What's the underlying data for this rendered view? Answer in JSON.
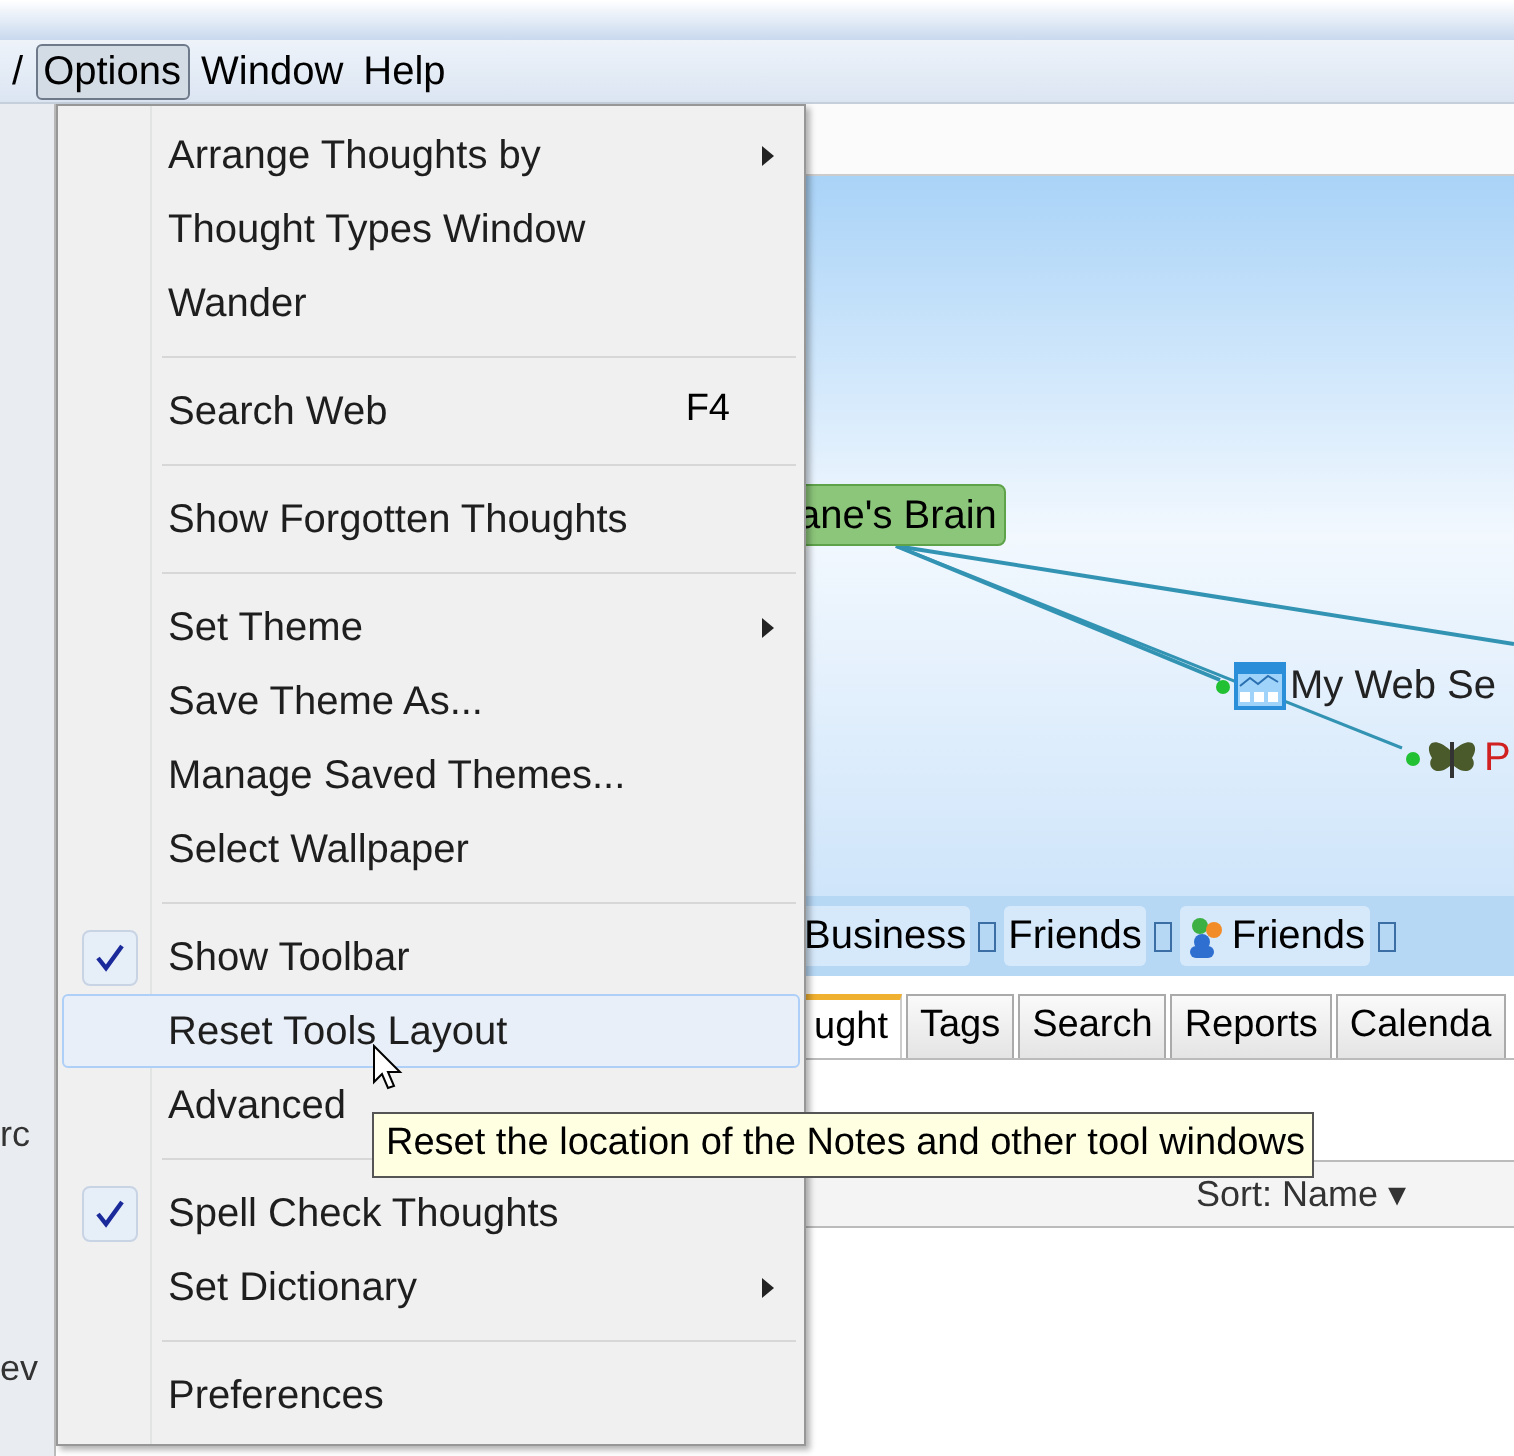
{
  "menubar": [
    {
      "label": "/",
      "selected": false
    },
    {
      "label": "Options",
      "selected": true
    },
    {
      "label": "Window",
      "selected": false
    },
    {
      "label": "Help",
      "selected": false
    }
  ],
  "menu": [
    {
      "kind": "item",
      "label": "Arrange Thoughts by",
      "submenu": true,
      "checked": false,
      "selected": false
    },
    {
      "kind": "item",
      "label": "Thought Types Window",
      "submenu": false,
      "checked": false,
      "selected": false
    },
    {
      "kind": "item",
      "label": "Wander",
      "submenu": false,
      "checked": false,
      "selected": false
    },
    {
      "kind": "separator"
    },
    {
      "kind": "item",
      "label": "Search Web",
      "shortcut": "F4",
      "submenu": false,
      "checked": false,
      "selected": false
    },
    {
      "kind": "separator"
    },
    {
      "kind": "item",
      "label": "Show Forgotten Thoughts",
      "submenu": false,
      "checked": false,
      "selected": false
    },
    {
      "kind": "separator"
    },
    {
      "kind": "item",
      "label": "Set Theme",
      "submenu": true,
      "checked": false,
      "selected": false
    },
    {
      "kind": "item",
      "label": "Save Theme As...",
      "submenu": false,
      "checked": false,
      "selected": false
    },
    {
      "kind": "item",
      "label": "Manage Saved Themes...",
      "submenu": false,
      "checked": false,
      "selected": false
    },
    {
      "kind": "item",
      "label": "Select Wallpaper",
      "submenu": false,
      "checked": false,
      "selected": false
    },
    {
      "kind": "separator"
    },
    {
      "kind": "item",
      "label": "Show Toolbar",
      "submenu": false,
      "checked": true,
      "selected": false
    },
    {
      "kind": "item",
      "label": "Reset Tools Layout",
      "submenu": false,
      "checked": false,
      "selected": true
    },
    {
      "kind": "item",
      "label": "Advanced",
      "submenu": false,
      "checked": false,
      "selected": false
    },
    {
      "kind": "separator"
    },
    {
      "kind": "item",
      "label": "Spell Check Thoughts",
      "submenu": false,
      "checked": true,
      "selected": false
    },
    {
      "kind": "item",
      "label": "Set Dictionary",
      "submenu": true,
      "checked": false,
      "selected": false
    },
    {
      "kind": "separator"
    },
    {
      "kind": "item",
      "label": "Preferences",
      "submenu": false,
      "checked": false,
      "selected": false
    }
  ],
  "tooltip": "Reset the location of the Notes and other tool windows",
  "left_strip": [
    "rc",
    "ev"
  ],
  "map": {
    "nodes": [
      {
        "kind": "central",
        "label": "ane's Brain"
      },
      {
        "kind": "web",
        "label": "My Web Se"
      },
      {
        "kind": "bug",
        "label": "P"
      }
    ]
  },
  "tags": [
    {
      "label": "Business",
      "icon": false
    },
    {
      "label": "Friends",
      "icon": false
    },
    {
      "label": "Friends",
      "icon": true
    }
  ],
  "tabs": [
    {
      "label": "ught",
      "selected": true
    },
    {
      "label": "Tags",
      "selected": false
    },
    {
      "label": "Search",
      "selected": false
    },
    {
      "label": "Reports",
      "selected": false
    },
    {
      "label": "Calenda",
      "selected": false
    }
  ],
  "sort": {
    "value": "Sort: Name",
    "arrow": "▾"
  }
}
